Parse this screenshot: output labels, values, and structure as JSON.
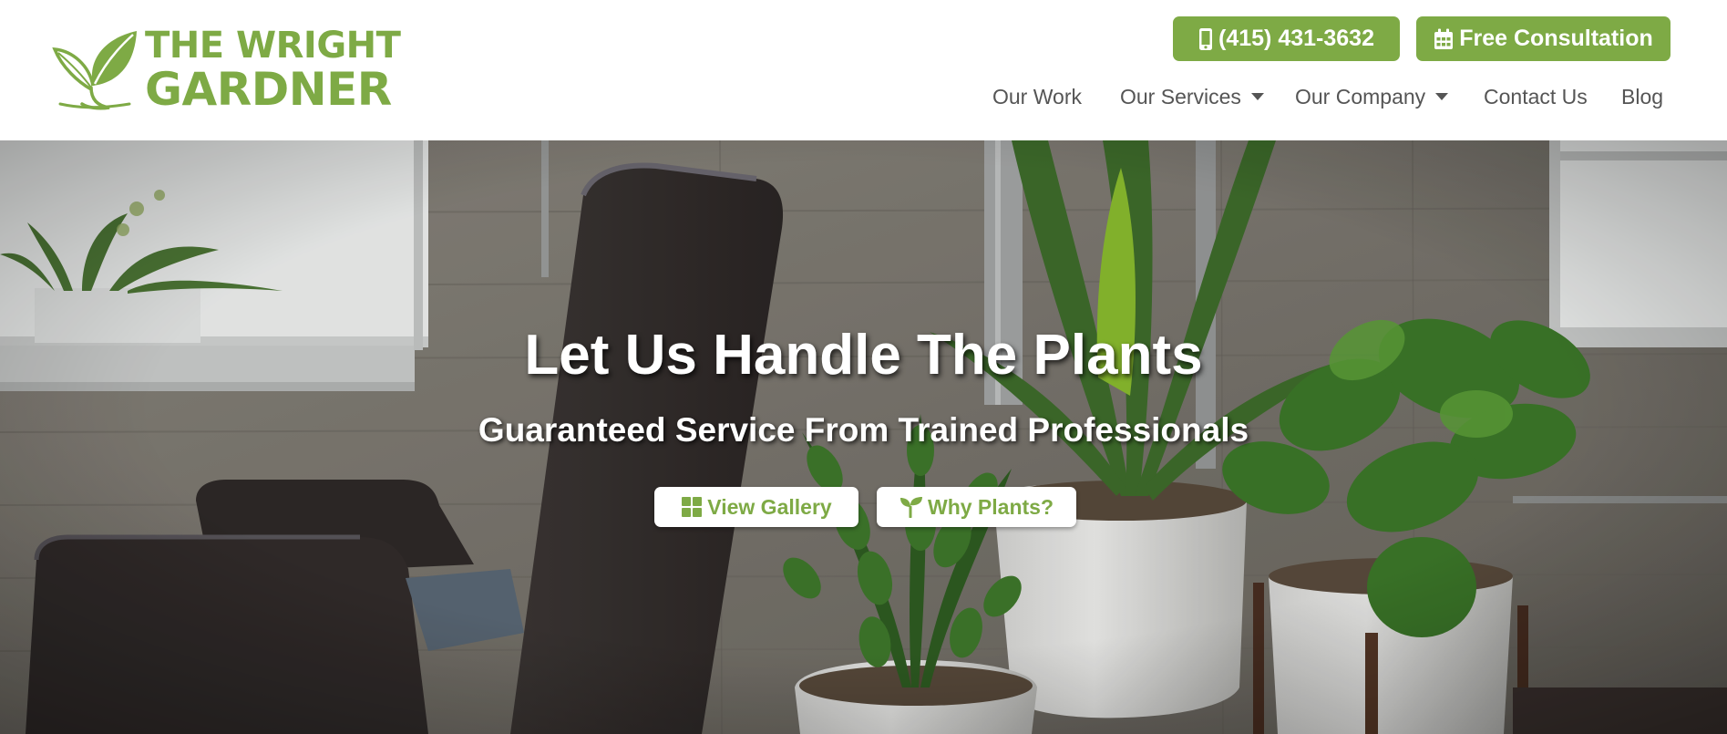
{
  "header": {
    "logo": {
      "line1": "THE WRIGHT",
      "line2": "GARDNER",
      "icon": "leaf-logo-icon",
      "brand_color": "#7eaa45"
    },
    "cta": {
      "phone": {
        "label": "(415) 431-3632",
        "icon": "mobile-phone-icon"
      },
      "consultation": {
        "label": "Free Consultation",
        "icon": "calendar-icon"
      }
    },
    "nav": {
      "items": [
        {
          "label": "Our Work",
          "has_dropdown": false
        },
        {
          "label": "Our Services",
          "has_dropdown": true
        },
        {
          "label": "Our Company",
          "has_dropdown": true
        },
        {
          "label": "Contact Us",
          "has_dropdown": false
        },
        {
          "label": "Blog",
          "has_dropdown": false
        }
      ]
    }
  },
  "hero": {
    "headline": "Let Us Handle The Plants",
    "subheadline": "Guaranteed Service From Trained Professionals",
    "buttons": {
      "gallery": {
        "label": "View Gallery",
        "icon": "grid-icon"
      },
      "why": {
        "label": "Why Plants?",
        "icon": "seedling-icon"
      }
    },
    "background": "office interior with dark armchair, concrete wall and potted plants"
  },
  "colors": {
    "accent": "#7eaa45",
    "nav_text": "#555555",
    "white": "#ffffff"
  }
}
